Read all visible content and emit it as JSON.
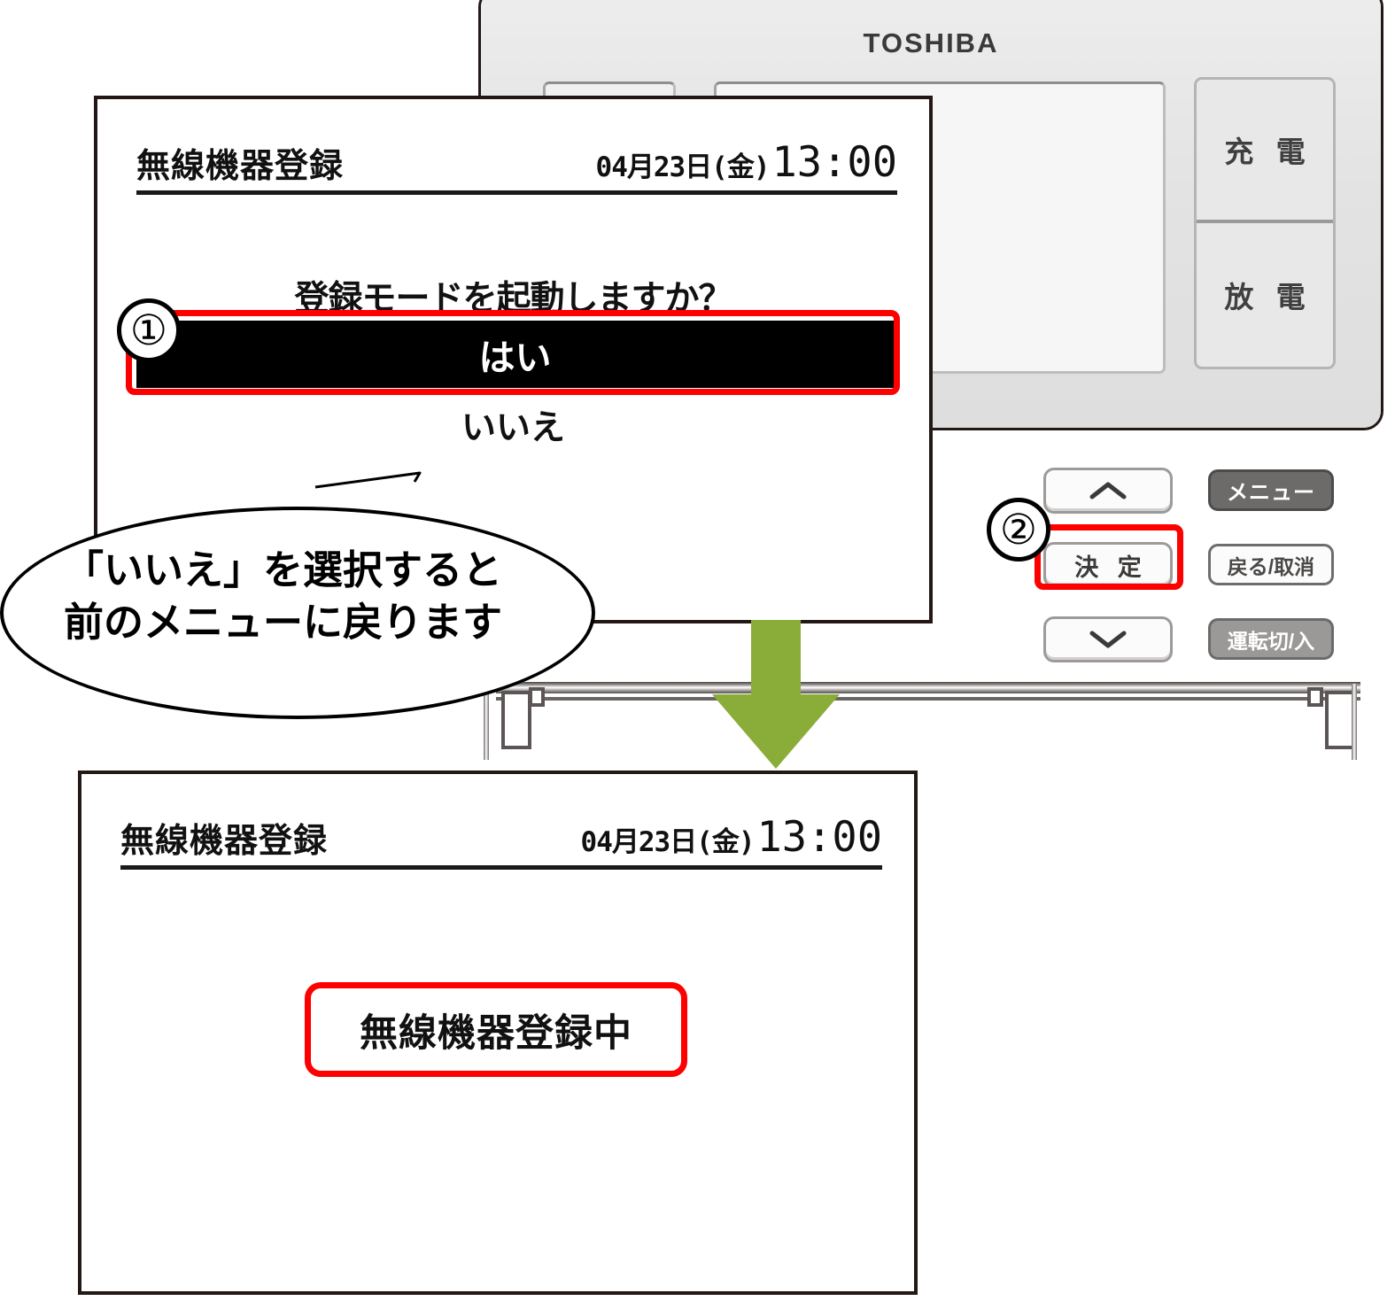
{
  "device": {
    "brand": "TOSHIBA",
    "side_buttons": [
      {
        "name": "charge",
        "label": "充 電"
      },
      {
        "name": "discharge",
        "label": "放 電"
      }
    ],
    "keypad": {
      "up_icon": "chevron-up-icon",
      "down_icon": "chevron-down-icon",
      "enter_label": "決 定",
      "menu_label": "メニュー",
      "back_cancel_label": "戻る/取消",
      "power_label": "運転切/入"
    }
  },
  "steps": [
    {
      "number": "①",
      "target": "yes-option"
    },
    {
      "number": "②",
      "target": "enter-button"
    }
  ],
  "screen1": {
    "title": "無線機器登録",
    "date": "04月23日(金)",
    "time": "13:00",
    "question": "登録モードを起動しますか？",
    "option_selected": "はい",
    "option_other": "いいえ"
  },
  "screen2": {
    "title": "無線機器登録",
    "date": "04月23日(金)",
    "time": "13:00",
    "status": "無線機器登録中"
  },
  "callout": {
    "line1": "「いいえ」を選択すると",
    "line2": "前のメニューに戻ります"
  },
  "flow": {
    "arrow_icon": "arrow-down-icon"
  },
  "colors": {
    "highlight": "#ff0000",
    "arrow": "#8aad3a",
    "lcd_text": "#111111",
    "device_body": "#e4e4e4"
  }
}
